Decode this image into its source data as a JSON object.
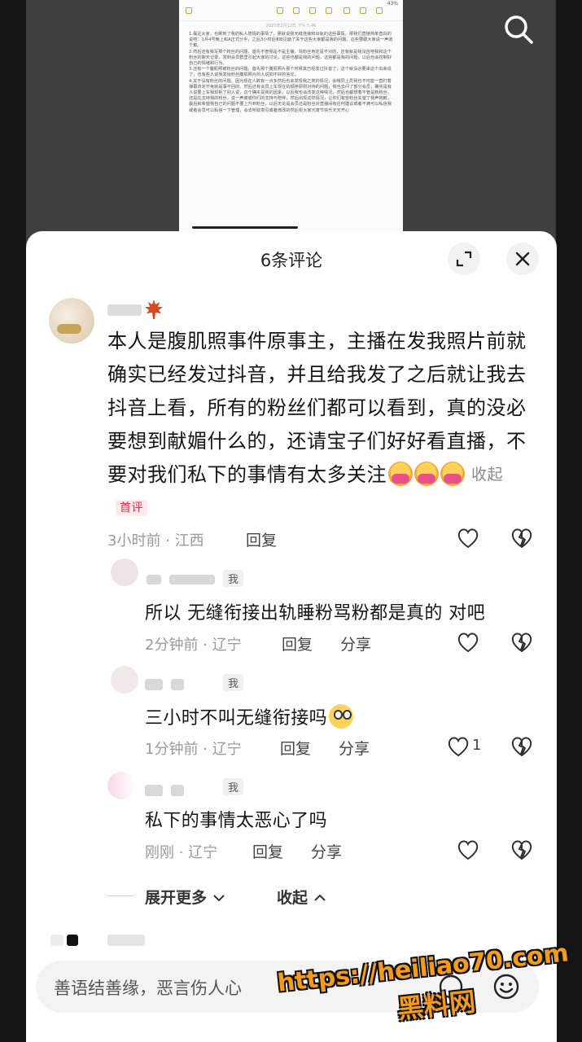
{
  "background_doc": {
    "status": "43%",
    "date": "2025年2月12日 下午 5:46",
    "paragraphs": [
      "1.最近大家，也刷到了我的私人感情的事情了，那就说我无缝连接和出轨的这些事情。那我们直接简单直白的说吧：1月4号晚上和A正式分手，之后3小时后和B见面了关于这些大家都是我的问题，这些要跟大家说一声道个歉。",
      "2.然后还有我写那个粉丝的问题，首先不管我是不是主播，骂粉丝肯定是不对的，还有就是我沒自吧我和这个粉丝的聊天记录，发到会员群里引起大家的讨论，这些也都是我的问题，这些都是我的问题，以后也会控制好自己的情绪和行为。",
      "3.还有一个腹肌照被粉丝的问题，首先那个腹肌照片那个时候其已经发过抖音了，这个就没必要来这个出来说了，也有些人说我发给粉丝腹肌照片的人说如不好的言论。",
      "4.关于没有粉丝的问题，因为现在人数有一点多然后也会发现我之类的情况，会哦同上员我也不可能一直盯着弹幕背定不免就是事不回的。然后还有会员上车现在的顺序原则对待的问题，我也去问了部分会员，确实是有人说要上车我却拒了别人说，这个确实是我的因素，以后我也会改变这种情况，然后也都想着不管是新粉丝，还是在支持我的粉丝，说一声谢谢你们的支持与陪伴，然后出现这样情况，让你们有些粉丝失望了我声抱歉，最后就希望我自己的问题不要上升到粉丝，以后无论是会员还是粉丝对直播间有任何建议或者不满可以私信我或者会员可以私信一下管理，会去听取意见或者修改的然后祝大家元宵节快乐天天开心"
    ]
  },
  "sheet": {
    "title": "6条评论"
  },
  "main_comment": {
    "text": "本人是腹肌照事件原事主，主播在发我照片前就确实已经发过抖音，并且给我发了之后就让我去抖音上看，所有的粉丝们都可以看到，真的没必要想到献媚什么的，还请宝子们好好看直播，不要对我们私下的事情有太多关注",
    "fold_label": "收起",
    "badge": "首评",
    "meta": "3小时前 · 江西",
    "reply_label": "回复"
  },
  "replies": [
    {
      "me_badge": "我",
      "text": "所以 无缝衔接出轨睡粉骂粉都是真的 对吧",
      "meta": "2分钟前 · 辽宁",
      "reply_label": "回复",
      "share_label": "分享",
      "likes": ""
    },
    {
      "me_badge": "我",
      "text": "三小时不叫无缝衔接吗",
      "meta": "1分钟前 · 辽宁",
      "reply_label": "回复",
      "share_label": "分享",
      "likes": "1"
    },
    {
      "me_badge": "我",
      "text": "私下的事情太恶心了吗",
      "meta": "刚刚 · 辽宁",
      "reply_label": "回复",
      "share_label": "分享",
      "likes": ""
    }
  ],
  "expand": {
    "more_label": "展开更多",
    "collapse_label": "收起"
  },
  "input": {
    "placeholder": "善语结善缘，恶言伤人心"
  },
  "watermark": {
    "url": "https://heiliao70.com",
    "name": "黑料网"
  }
}
